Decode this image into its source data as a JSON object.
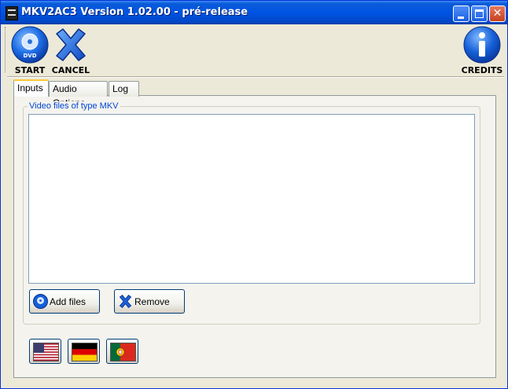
{
  "window": {
    "title": "MKV2AC3 Version 1.02.00 - pré-release",
    "controls": [
      "minimize",
      "maximize",
      "close"
    ]
  },
  "toolbar": {
    "start_label": "START",
    "cancel_label": "CANCEL",
    "credits_label": "CREDITS",
    "start_icon": "dvd-disc-icon",
    "cancel_icon": "blue-x-icon",
    "credits_icon": "info-icon"
  },
  "tabs": [
    {
      "label": "Inputs",
      "selected": true
    },
    {
      "label": "Audio Options",
      "selected": false
    },
    {
      "label": "Log",
      "selected": false
    }
  ],
  "inputs": {
    "group_label": "Video files of type MKV",
    "files": [],
    "add_files_label": "Add files",
    "remove_label": "Remove"
  },
  "languages": [
    {
      "name": "english",
      "icon": "us-flag-icon"
    },
    {
      "name": "german",
      "icon": "german-flag-icon"
    },
    {
      "name": "portuguese",
      "icon": "portugal-flag-icon"
    }
  ],
  "colors": {
    "titlebar": "#0054e3",
    "accent_blue": "#1560d8",
    "group_label": "#0046d5",
    "window_bg": "#ece9d8"
  }
}
